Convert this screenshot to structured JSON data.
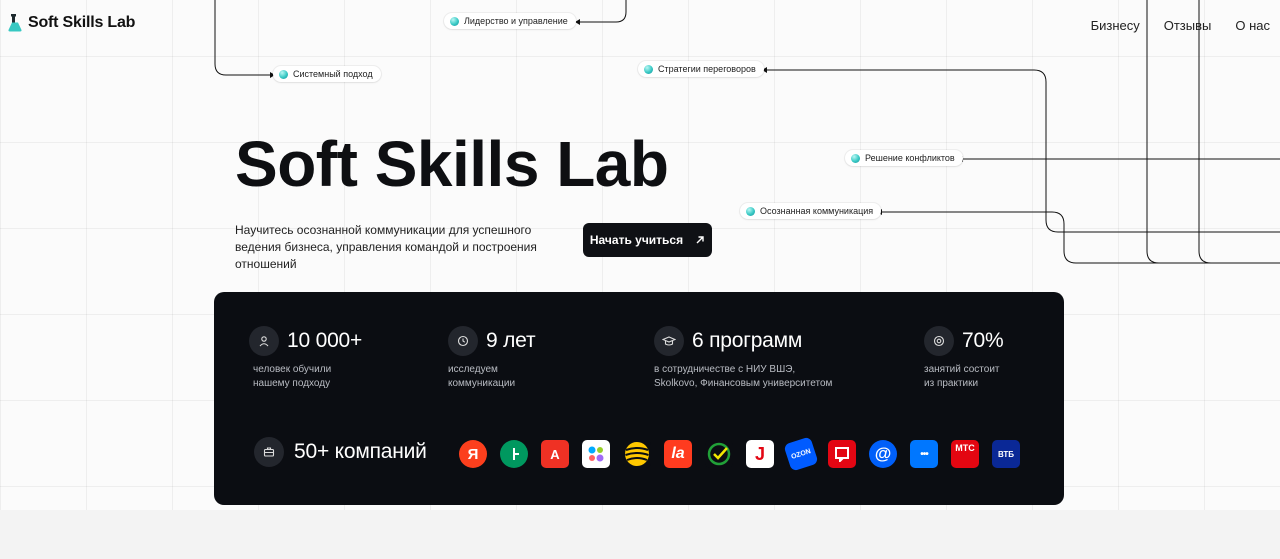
{
  "header": {
    "logo_text": "Soft Skills Lab",
    "nav": [
      "Бизнесу",
      "Отзывы",
      "О нас"
    ]
  },
  "pills": {
    "leadership": "Лидерство и управление",
    "system": "Системный подход",
    "negotiation": "Стратегии переговоров",
    "conflict": "Решение конфликтов",
    "mindful": "Осознанная коммуникация"
  },
  "hero": {
    "title": "Soft Skills Lab",
    "description": "Научитесь осознанной коммуникации для успешного ведения бизнеса, управления командой и построения отношений",
    "cta": "Начать учиться"
  },
  "stats": [
    {
      "icon": "user-icon",
      "value": "10 000+",
      "desc_1": "человек обучили",
      "desc_2": "нашему подходу"
    },
    {
      "icon": "clock-icon",
      "value": "9 лет",
      "desc_1": "исследуем",
      "desc_2": "коммуникации"
    },
    {
      "icon": "graduation-cap-icon",
      "value": "6 программ",
      "desc_1": "в сотрудничестве с НИУ ВШЭ,",
      "desc_2": "Skolkovo, Финансовым университетом"
    },
    {
      "icon": "target-icon",
      "value": "70%",
      "desc_1": "занятий состоит",
      "desc_2": "из практики"
    }
  ],
  "companies": {
    "icon": "briefcase-icon",
    "label": "50+ компаний",
    "logos": [
      {
        "name": "yandex-logo",
        "text": "Я",
        "bg": "#fc3f1d"
      },
      {
        "name": "megafon-logo",
        "text": "",
        "bg": "#00985f"
      },
      {
        "name": "alfa-bank-logo",
        "text": "А",
        "bg": "#ef3124"
      },
      {
        "name": "avito-logo",
        "text": "",
        "bg": "#ffffff"
      },
      {
        "name": "beeline-logo",
        "text": "",
        "bg": "#0b0d12"
      },
      {
        "name": "lamoda-logo",
        "text": "la",
        "bg": "#ff3b1f"
      },
      {
        "name": "sber-logo",
        "text": "",
        "bg": "#0b0d12"
      },
      {
        "name": "lukoil-logo",
        "text": "J",
        "bg": "#ffffff"
      },
      {
        "name": "ozon-logo",
        "text": "OZON",
        "bg": "#005bff"
      },
      {
        "name": "sportmaster-logo",
        "text": "",
        "bg": "#e30613"
      },
      {
        "name": "mail-ru-logo",
        "text": "@",
        "bg": "#005ff9"
      },
      {
        "name": "vk-logo",
        "text": "•••",
        "bg": "#0077ff"
      },
      {
        "name": "mts-logo",
        "text": "МТС",
        "bg": "#e30611"
      },
      {
        "name": "vtb-logo",
        "text": "ВТБ",
        "bg": "#0a2896"
      }
    ]
  },
  "colors": {
    "panel": "#0b0d12",
    "accent_dot": "#38c9c4",
    "cta": "#0f1115"
  }
}
